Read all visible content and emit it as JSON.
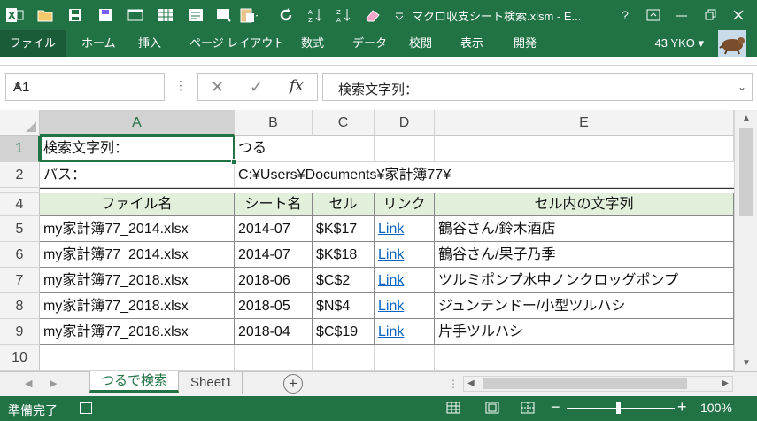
{
  "app": {
    "window_title": "マクロ収支シート検索.xlsm - E...",
    "help": "?",
    "user": "43 YKO"
  },
  "ribbon": {
    "tabs": [
      "ファイル",
      "ホーム",
      "挿入",
      "ページ レイアウト",
      "数式",
      "データ",
      "校閲",
      "表示",
      "開発"
    ]
  },
  "formula_bar": {
    "name_box": "A1",
    "fx": "fx",
    "content": "検索文字列："
  },
  "grid": {
    "columns": [
      "A",
      "B",
      "C",
      "D",
      "E"
    ],
    "row_numbers": [
      "1",
      "2",
      "4",
      "5",
      "6",
      "7",
      "8",
      "9",
      "10"
    ],
    "rows": [
      {
        "A": "検索文字列：",
        "B": "つる"
      },
      {
        "A": "パス：",
        "B": "C:¥Users¥Documents¥家計簿77¥"
      },
      {
        "A": "ファイル名",
        "B": "シート名",
        "C": "セル",
        "D": "リンク",
        "E": "セル内の文字列"
      },
      {
        "A": "my家計簿77_2014.xlsx",
        "B": "2014-07",
        "C": "$K$17",
        "D": "Link",
        "E": "鶴谷さん/鈴木酒店"
      },
      {
        "A": "my家計簿77_2014.xlsx",
        "B": "2014-07",
        "C": "$K$18",
        "D": "Link",
        "E": "鶴谷さん/果子乃季"
      },
      {
        "A": "my家計簿77_2018.xlsx",
        "B": "2018-06",
        "C": "$C$2",
        "D": "Link",
        "E": "ツルミポンプ水中ノンクロッグポンプ"
      },
      {
        "A": "my家計簿77_2018.xlsx",
        "B": "2018-05",
        "C": "$N$4",
        "D": "Link",
        "E": "ジュンテンドー/小型ツルハシ"
      },
      {
        "A": "my家計簿77_2018.xlsx",
        "B": "2018-04",
        "C": "$C$19",
        "D": "Link",
        "E": "片手ツルハシ"
      }
    ]
  },
  "sheets": {
    "active": "つるで検索",
    "other": "Sheet1"
  },
  "status": {
    "text": "準備完了",
    "zoom": "100%"
  },
  "colors": {
    "excel_green": "#217346",
    "header_fill": "#e2efda",
    "link": "#0563c1"
  }
}
